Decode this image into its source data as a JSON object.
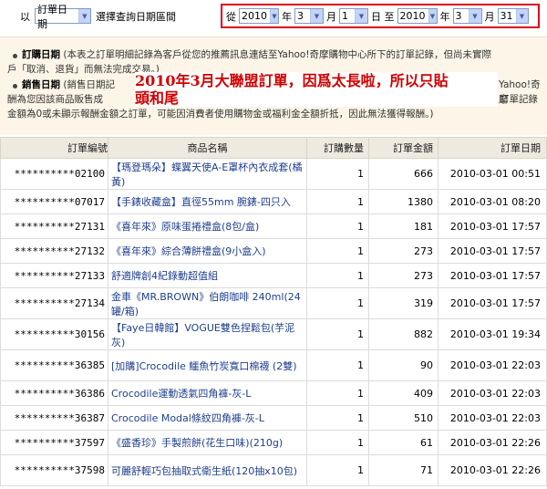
{
  "filter": {
    "prefix": "以",
    "date_type": "訂單日期",
    "instruction": "選擇查詢日期區間",
    "from_label": "從",
    "to_label": "日 至",
    "unit_year": "年",
    "unit_month": "月",
    "from_year": "2010",
    "from_month": "3",
    "from_day": "1",
    "to_year": "2010",
    "to_month": "3",
    "to_day": "31"
  },
  "notes": {
    "order_date_title": "訂購日期",
    "order_date_line1": "(本表之訂單明細記錄為客戶從您的推薦訊息連結至Yahoo!奇摩購物中心所下的訂單記錄，但尚未實際",
    "order_date_line2": "戶「取消、退貨」而無法完成交易。)",
    "sales_date_title": "銷售日期",
    "sales_line1": "(銷售日期記",
    "sales_line1_tail": "Yahoo!奇摩",
    "sales_line2": "酬為您因該商品販售成",
    "sales_line2_tail": "訂單記錄",
    "sales_line3": "金額為0或未顯示報酬金額之訂單，可能因消費者使用購物金或福利金全額折抵，因此無法獲得報酬。)"
  },
  "overlay": {
    "line1": "2010年3月大聯盟訂單，因爲太長啦，所以只貼",
    "line2": "頭和尾"
  },
  "table": {
    "headers": [
      "訂單編號",
      "商品名稱",
      "訂購數量",
      "訂單金額",
      "訂單日期"
    ],
    "rows": [
      {
        "no": "**********02100",
        "name": "【瑪登瑪朵】蝶翼天使A-E罩杯內衣成套(橘黃)",
        "qty": "1",
        "amount": "666",
        "date": "2010-03-01 00:51"
      },
      {
        "no": "**********07017",
        "name": "【手錶收藏盒】直徑55mm 腕錶-四只入",
        "qty": "1",
        "amount": "1380",
        "date": "2010-03-01 08:20"
      },
      {
        "no": "**********27131",
        "name": "《喜年來》原味蛋捲禮盒(8包/盒)",
        "qty": "1",
        "amount": "181",
        "date": "2010-03-01 17:57"
      },
      {
        "no": "**********27132",
        "name": "《喜年來》綜合薄餅禮盒(9小盒入)",
        "qty": "1",
        "amount": "273",
        "date": "2010-03-01 17:57"
      },
      {
        "no": "**********27133",
        "name": "舒適牌創4紀錄動超值組",
        "qty": "1",
        "amount": "273",
        "date": "2010-03-01 17:57"
      },
      {
        "no": "**********27134",
        "name": "金車《MR.BROWN》伯朗咖啡 240ml(24罐/箱)",
        "qty": "1",
        "amount": "319",
        "date": "2010-03-01 17:57"
      },
      {
        "no": "**********30156",
        "name": "【Faye日韓館】VOGUE雙色捏鬆包(芋泥灰)",
        "qty": "1",
        "amount": "882",
        "date": "2010-03-01 19:34"
      },
      {
        "no": "**********36385",
        "name": "[加購]Crocodile 鱷魚竹炭寬口棉襪 (2雙)",
        "qty": "1",
        "amount": "90",
        "date": "2010-03-01 22:03"
      },
      {
        "no": "**********36386",
        "name": "Crocodile運動透氣四角褲-灰-L",
        "qty": "1",
        "amount": "409",
        "date": "2010-03-01 22:03"
      },
      {
        "no": "**********36387",
        "name": "Crocodile Modal條紋四角褲-灰-L",
        "qty": "1",
        "amount": "510",
        "date": "2010-03-01 22:03"
      },
      {
        "no": "**********37597",
        "name": "《盛香珍》手製煎餅(花生口味)(210g)",
        "qty": "1",
        "amount": "61",
        "date": "2010-03-01 22:26"
      },
      {
        "no": "**********37598",
        "name": "可麗舒輕巧包抽取式衛生紙(120抽x10包)",
        "qty": "1",
        "amount": "71",
        "date": "2010-03-01 22:26"
      }
    ]
  }
}
